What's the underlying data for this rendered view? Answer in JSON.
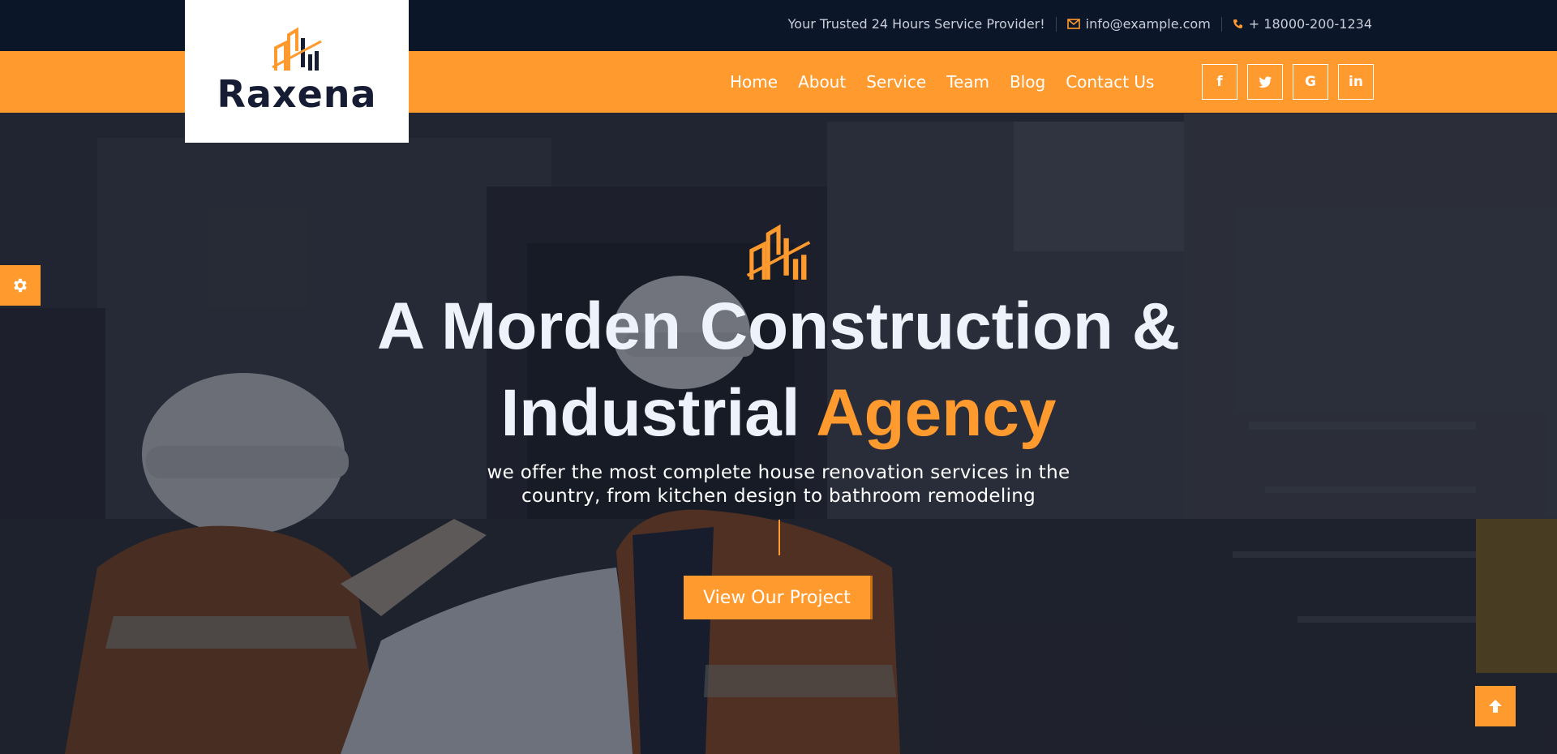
{
  "topbar": {
    "tagline": "Your Trusted 24 Hours Service Provider!",
    "email": "info@example.com",
    "phone": "+ 18000-200-1234",
    "email_icon": "envelope-icon",
    "phone_icon": "phone-icon"
  },
  "logo": {
    "text": "Raxena",
    "icon": "building-chart-logo-icon"
  },
  "nav": {
    "items": [
      {
        "label": "Home"
      },
      {
        "label": "About"
      },
      {
        "label": "Service"
      },
      {
        "label": "Team"
      },
      {
        "label": "Blog"
      },
      {
        "label": "Contact Us"
      }
    ]
  },
  "socials": [
    {
      "icon": "facebook-icon",
      "glyph": "f"
    },
    {
      "icon": "twitter-icon",
      "glyph": ""
    },
    {
      "icon": "google-icon",
      "glyph": "G"
    },
    {
      "icon": "linkedin-icon",
      "glyph": "in"
    }
  ],
  "hero": {
    "headline_line1": "A Morden Construction &",
    "headline_line2_prefix": "Industrial ",
    "headline_line2_accent": "Agency",
    "subtitle_line1": "we offer the most complete house renovation services in the",
    "subtitle_line2": "country, from kitchen design to bathroom remodeling",
    "cta_label": "View Our Project"
  },
  "colors": {
    "accent": "#ff9a2e",
    "dark": "#0c1629",
    "headline": "#eef3fb"
  },
  "widgets": {
    "settings_icon": "gear-icon",
    "scroll_top_icon": "arrow-up-icon"
  }
}
